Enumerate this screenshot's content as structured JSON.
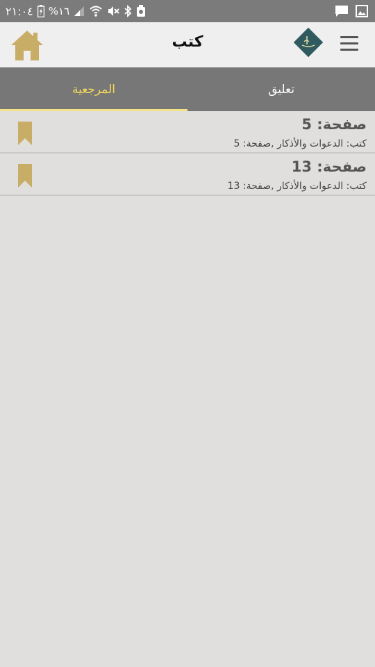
{
  "status_bar": {
    "time": "٢١:٠٤",
    "battery": "%١٦"
  },
  "app_bar": {
    "title": "كتب"
  },
  "tabs": [
    {
      "label": "تعليق",
      "active": false
    },
    {
      "label": "المرجعية",
      "active": true
    }
  ],
  "bookmarks": [
    {
      "title": "صفحة: 5",
      "subtitle": "كتب: الدعوات والأذكار ,صفحة: 5"
    },
    {
      "title": "صفحة: 13",
      "subtitle": "كتب: الدعوات والأذكار ,صفحة: 13"
    }
  ],
  "colors": {
    "accent": "#c8ad66",
    "tab_bar": "#777777",
    "active_tab_text": "#f5da5c",
    "logo": "#2f5a5f"
  }
}
